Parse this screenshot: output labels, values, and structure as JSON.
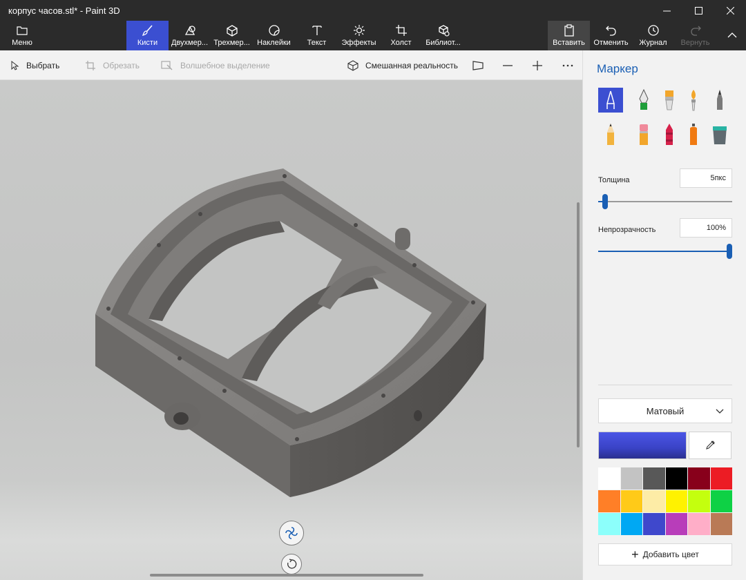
{
  "window": {
    "title": "корпус часов.stl* - Paint 3D"
  },
  "ribbon": {
    "menu": "Меню",
    "tabs": [
      "Кисти",
      "Двухмер...",
      "Трехмер...",
      "Наклейки",
      "Текст",
      "Эффекты",
      "Холст",
      "Библиот..."
    ],
    "active_tab": "Кисти",
    "actions": {
      "paste": "Вставить",
      "undo": "Отменить",
      "history": "Журнал",
      "redo": "Вернуть"
    }
  },
  "toolbar": {
    "select": "Выбрать",
    "crop": "Обрезать",
    "magic_select": "Волшебное выделение",
    "mixed_reality": "Смешанная реальность"
  },
  "panel": {
    "title": "Маркер",
    "brushes": [
      "marker",
      "calligraphy-pen",
      "oil-brush",
      "watercolor",
      "pixel-pen",
      "pencil",
      "eraser",
      "crayon",
      "spray-can",
      "fill"
    ],
    "selected_brush": "marker",
    "thickness": {
      "label": "Толщина",
      "value": "5пкс",
      "level": 0.05
    },
    "opacity": {
      "label": "Непрозрачность",
      "value": "100%",
      "level": 1.0
    },
    "finish": "Матовый",
    "current_color": "#3b46c9",
    "palette": [
      "#ffffff",
      "#c3c3c3",
      "#585858",
      "#000000",
      "#88001b",
      "#ec1c24",
      "#ff7f27",
      "#ffca18",
      "#fdeca6",
      "#fff200",
      "#c4ff0e",
      "#0ed145",
      "#8cfffb",
      "#00a8f3",
      "#3f48cc",
      "#b83dba",
      "#ffaec8",
      "#b97a56"
    ],
    "add_color": "Добавить цвет"
  }
}
